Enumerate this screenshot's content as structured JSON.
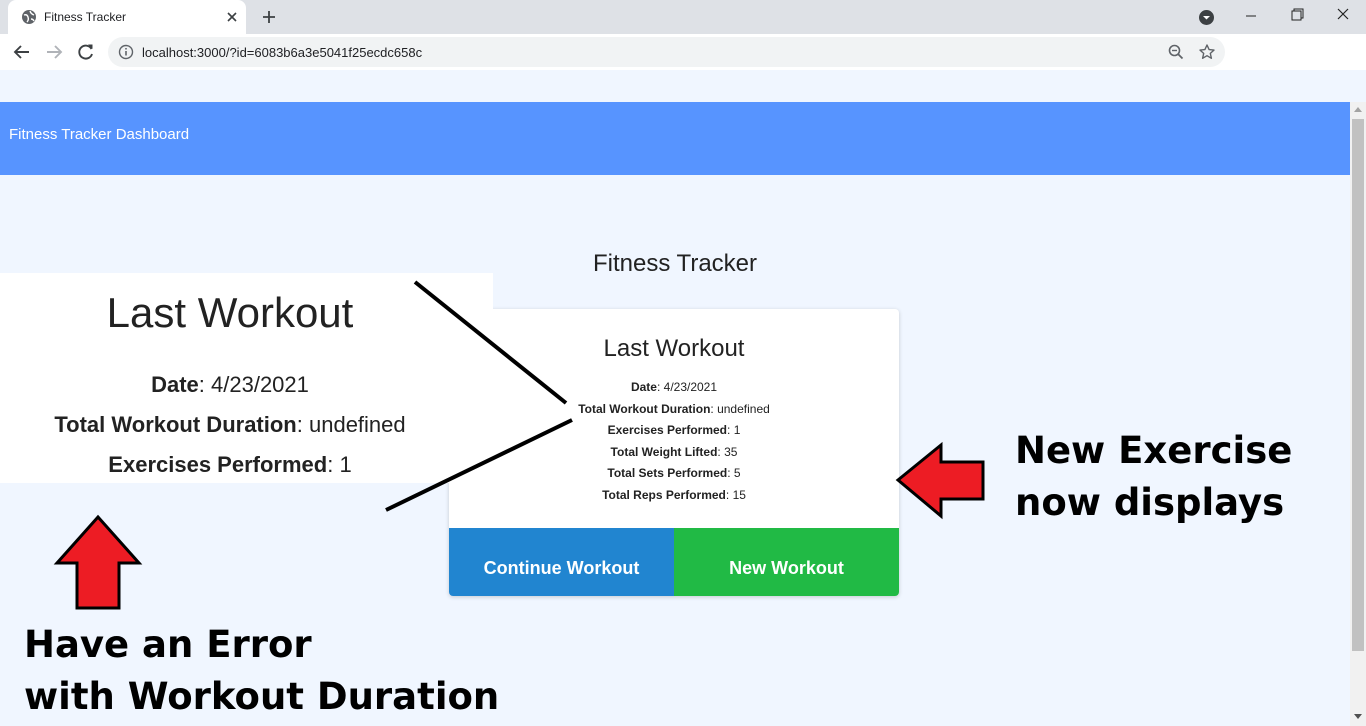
{
  "browser": {
    "tab_title": "Fitness Tracker",
    "url": "localhost:3000/?id=6083b6a3e5041f25ecdc658c"
  },
  "page": {
    "brand": "Fitness Tracker Dashboard",
    "heading": "Fitness Tracker",
    "card": {
      "title": "Last Workout",
      "stats": [
        {
          "label": "Date",
          "value": "4/23/2021"
        },
        {
          "label": "Total Workout Duration",
          "value": "undefined"
        },
        {
          "label": "Exercises Performed",
          "value": "1"
        },
        {
          "label": "Total Weight Lifted",
          "value": "35"
        },
        {
          "label": "Total Sets Performed",
          "value": "5"
        },
        {
          "label": "Total Reps Performed",
          "value": "15"
        }
      ],
      "continue_label": "Continue Workout",
      "new_label": "New Workout"
    }
  },
  "annotations": {
    "zoom_title": "Last Workout",
    "zoom_stats": [
      {
        "label": "Date",
        "value": "4/23/2021"
      },
      {
        "label": "Total Workout Duration",
        "value": "undefined"
      },
      {
        "label": "Exercises Performed",
        "value": "1"
      }
    ],
    "error_note_line1": "Have an Error",
    "error_note_line2": "with Workout Duration",
    "new_exercise_line1": "New Exercise",
    "new_exercise_line2": "now displays"
  },
  "colors": {
    "navbar": "#5794ff",
    "continue_button": "#2185d0",
    "new_button": "#21ba45",
    "arrow": "#ed1c24",
    "page_background": "#f0f6ff"
  }
}
